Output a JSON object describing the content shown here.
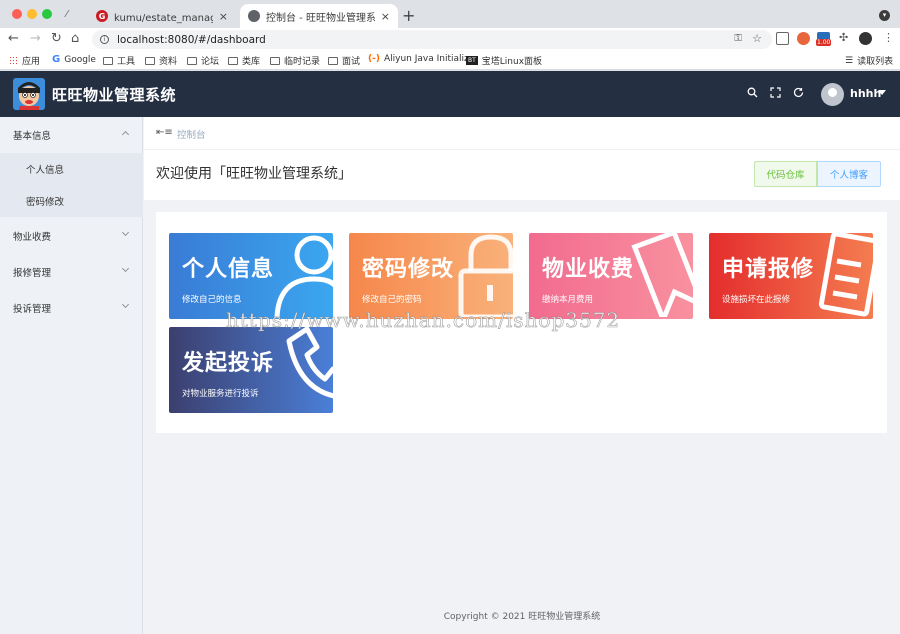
{
  "browser": {
    "tabs": [
      {
        "title": "kumu/estate_management - 码",
        "active": false
      },
      {
        "title": "控制台 - 旺旺物业管理系统",
        "active": true
      }
    ],
    "url": "localhost:8080/#/dashboard",
    "bookmarks": [
      "应用",
      "Google",
      "工具",
      "资料",
      "论坛",
      "类库",
      "临时记录",
      "面试",
      "Aliyun Java Initializr",
      "宝塔Linux面板"
    ],
    "reading_list": "读取列表",
    "ext_badge": "1.00"
  },
  "header": {
    "title": "旺旺物业管理系统",
    "username": "hhhh"
  },
  "sidebar": {
    "items": [
      {
        "label": "基本信息",
        "expanded": true,
        "children": [
          "个人信息",
          "密码修改"
        ]
      },
      {
        "label": "物业收费",
        "expanded": false
      },
      {
        "label": "报修管理",
        "expanded": false
      },
      {
        "label": "投诉管理",
        "expanded": false
      }
    ]
  },
  "main": {
    "breadcrumb": "控制台",
    "welcome": "欢迎使用「旺旺物业管理系统」",
    "btn_repo": "代码仓库",
    "btn_blog": "个人博客",
    "cards": [
      {
        "title": "个人信息",
        "desc": "修改自己的信息",
        "icon": "user-icon"
      },
      {
        "title": "密码修改",
        "desc": "修改自己的密码",
        "icon": "lock-icon"
      },
      {
        "title": "物业收费",
        "desc": "缴纳本月费用",
        "icon": "bookmark-icon"
      },
      {
        "title": "申请报修",
        "desc": "设施损坏在此报修",
        "icon": "document-icon"
      },
      {
        "title": "发起投诉",
        "desc": "对物业服务进行投诉",
        "icon": "phone-icon"
      }
    ],
    "footer": "Copyright © 2021 旺旺物业管理系统"
  },
  "watermark": "https://www.huzhan.com/ishop3572",
  "colors": {
    "header_bg": "#242f42",
    "sidebar_bg": "#eef1f6",
    "card1": [
      "#3a7bd5",
      "#3ba7f0"
    ],
    "card2": [
      "#f6874b",
      "#f9b27a"
    ],
    "card3": [
      "#f4668f",
      "#f88ea6"
    ],
    "card4": [
      "#e42d2d",
      "#f47c50"
    ],
    "card5": [
      "#3c3f6e",
      "#4a7fd8"
    ]
  }
}
